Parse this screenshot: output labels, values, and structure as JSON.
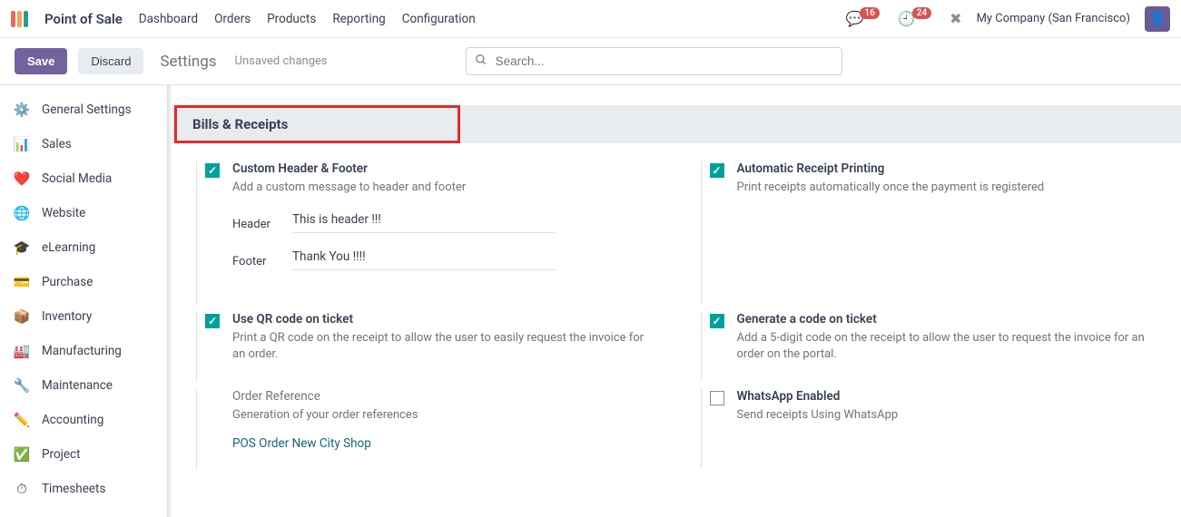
{
  "header": {
    "app_name": "Point of Sale",
    "nav": [
      "Dashboard",
      "Orders",
      "Products",
      "Reporting",
      "Configuration"
    ],
    "msg_badge": "16",
    "activity_badge": "24",
    "company": "My Company (San Francisco)"
  },
  "actionbar": {
    "save": "Save",
    "discard": "Discard",
    "title": "Settings",
    "unsaved": "Unsaved changes",
    "search_placeholder": "Search..."
  },
  "sidebar": {
    "items": [
      {
        "label": "General Settings",
        "emoji": "⚙️",
        "color": "#f39c12"
      },
      {
        "label": "Sales",
        "emoji": "📊",
        "color": "#f39c12"
      },
      {
        "label": "Social Media",
        "emoji": "❤️",
        "color": "#e74c3c"
      },
      {
        "label": "Website",
        "emoji": "🌐",
        "color": "#1abc9c"
      },
      {
        "label": "eLearning",
        "emoji": "🎓",
        "color": "#16a085"
      },
      {
        "label": "Purchase",
        "emoji": "💳",
        "color": "#16a085"
      },
      {
        "label": "Inventory",
        "emoji": "📦",
        "color": "#e67e22"
      },
      {
        "label": "Manufacturing",
        "emoji": "🏭",
        "color": "#d35400"
      },
      {
        "label": "Maintenance",
        "emoji": "🔧",
        "color": "#3498db"
      },
      {
        "label": "Accounting",
        "emoji": "✏️",
        "color": "#9b59b6"
      },
      {
        "label": "Project",
        "emoji": "✅",
        "color": "#2ecc71"
      },
      {
        "label": "Timesheets",
        "emoji": "⏱",
        "color": "#e74c3c"
      }
    ]
  },
  "section": {
    "title": "Bills & Receipts"
  },
  "settings": {
    "custom_hf": {
      "title": "Custom Header & Footer",
      "desc": "Add a custom message to header and footer",
      "header_label": "Header",
      "header_value": "This is header !!!",
      "footer_label": "Footer",
      "footer_value": "Thank You !!!!"
    },
    "auto_print": {
      "title": "Automatic Receipt Printing",
      "desc": "Print receipts automatically once the payment is registered"
    },
    "qr": {
      "title": "Use QR code on ticket",
      "desc": "Print a QR code on the receipt to allow the user to easily request the invoice for an order."
    },
    "gen_code": {
      "title": "Generate a code on ticket",
      "desc": "Add a 5-digit code on the receipt to allow the user to request the invoice for an order on the portal."
    },
    "order_ref": {
      "title": "Order Reference",
      "desc": "Generation of your order references",
      "link": "POS Order New City Shop"
    },
    "whatsapp": {
      "title": "WhatsApp Enabled",
      "desc": "Send receipts Using WhatsApp"
    }
  }
}
